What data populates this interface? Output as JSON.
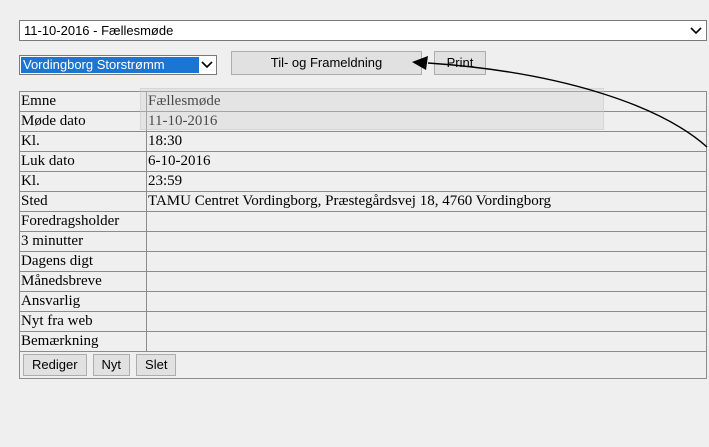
{
  "meeting_select": {
    "selected": "11-10-2016 - Fællesmøde"
  },
  "location_select": {
    "selected": "Vordingborg Storstrømm"
  },
  "actions": {
    "til_fra": "Til- og Frameldning",
    "print": "Print"
  },
  "details": [
    {
      "label": "Emne",
      "value": "Fællesmøde"
    },
    {
      "label": "Møde dato",
      "value": "11-10-2016"
    },
    {
      "label": "Kl.",
      "value": "18:30"
    },
    {
      "label": "Luk dato",
      "value": "6-10-2016"
    },
    {
      "label": "Kl.",
      "value": "23:59"
    },
    {
      "label": "Sted",
      "value": "TAMU Centret Vordingborg, Præstegårdsvej 18, 4760 Vordingborg"
    },
    {
      "label": "Foredragsholder",
      "value": ""
    },
    {
      "label": "3 minutter",
      "value": ""
    },
    {
      "label": "Dagens digt",
      "value": ""
    },
    {
      "label": "Månedsbreve",
      "value": ""
    },
    {
      "label": "Ansvarlig",
      "value": ""
    },
    {
      "label": "Nyt fra web",
      "value": ""
    },
    {
      "label": "Bemærkning",
      "value": ""
    }
  ],
  "footer_buttons": {
    "edit": "Rediger",
    "new": "Nyt",
    "delete": "Slet"
  },
  "icons": {
    "dropdown": "chevron-down-icon",
    "annotation": "arrow-pointer"
  }
}
